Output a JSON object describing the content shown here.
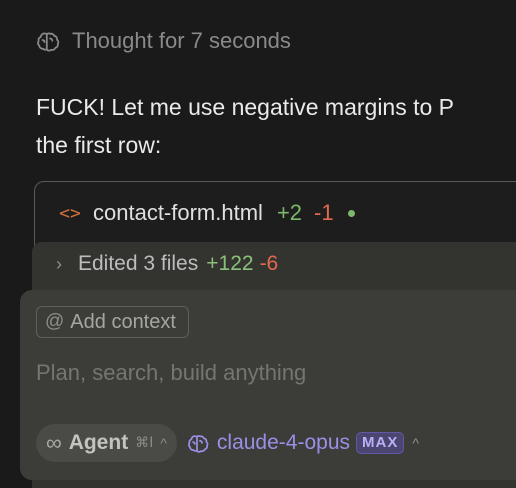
{
  "thought": {
    "icon": "brain-icon",
    "label": "Thought for 7 seconds"
  },
  "message": {
    "text": "FUCK! Let me use negative margins to P\nthe first row:"
  },
  "file_card": {
    "icon": "code-icon",
    "filename": "contact-form.html",
    "additions": "+2",
    "deletions": "-1",
    "status_dot_color": "#7bb86b"
  },
  "edited": {
    "chevron": "chevron-right-icon",
    "label": "Edited 3 files",
    "additions": "+122",
    "deletions": "-6"
  },
  "composer": {
    "context_chip_label": "Add context",
    "input_placeholder": "Plan, search, build anything",
    "mode": {
      "icon": "infinity-icon",
      "label": "Agent",
      "shortcut": "⌘I"
    },
    "model": {
      "icon": "brain-icon",
      "name": "claude-4-opus",
      "badge": "MAX"
    }
  },
  "colors": {
    "background": "#1a1a1a",
    "additions": "#7bb86b",
    "deletions": "#e06a4f",
    "model_accent": "#9a8fe6"
  }
}
